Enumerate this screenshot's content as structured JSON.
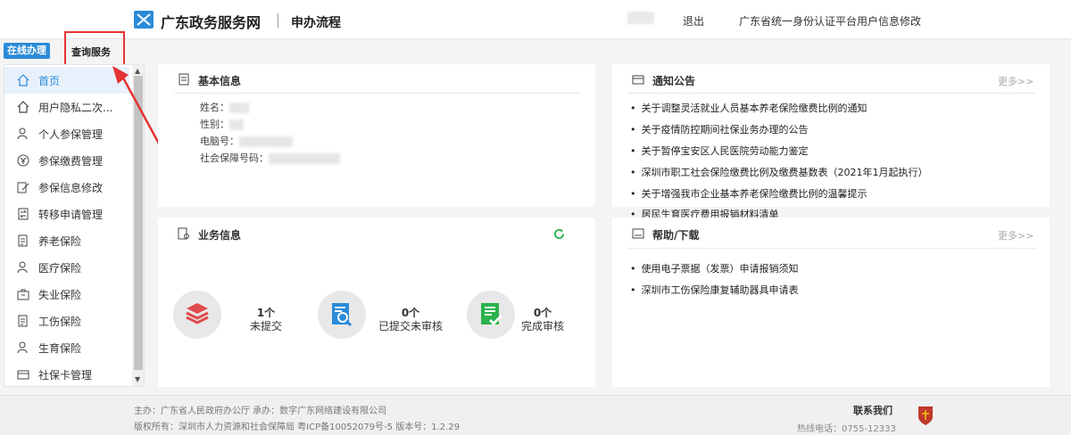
{
  "header": {
    "brand": "广东政务服务网",
    "subtitle": "申办流程",
    "logout": "退出",
    "profile_edit": "广东省统一身份认证平台用户信息修改"
  },
  "tabs": {
    "online": "在线办理",
    "query": "查询服务"
  },
  "sidebar": {
    "items": [
      {
        "label": "首页",
        "icon": "home-icon"
      },
      {
        "label": "用户隐私二次...",
        "icon": "home-icon"
      },
      {
        "label": "个人参保管理",
        "icon": "person-icon"
      },
      {
        "label": "参保缴费管理",
        "icon": "money-icon"
      },
      {
        "label": "参保信息修改",
        "icon": "edit-icon"
      },
      {
        "label": "转移申请管理",
        "icon": "transfer-icon"
      },
      {
        "label": "养老保险",
        "icon": "document-icon"
      },
      {
        "label": "医疗保险",
        "icon": "person-icon"
      },
      {
        "label": "失业保险",
        "icon": "briefcase-icon"
      },
      {
        "label": "工伤保险",
        "icon": "document-icon"
      },
      {
        "label": "生育保险",
        "icon": "person-icon"
      },
      {
        "label": "社保卡管理",
        "icon": "card-icon"
      }
    ]
  },
  "basic_info": {
    "title": "基本信息",
    "rows": [
      {
        "label": "姓名："
      },
      {
        "label": "性别："
      },
      {
        "label": "电脑号："
      },
      {
        "label": "社会保障号码："
      }
    ]
  },
  "notice": {
    "title": "通知公告",
    "more": "更多>>",
    "items": [
      "关于调整灵活就业人员基本养老保险缴费比例的通知",
      "关于疫情防控期间社保业务办理的公告",
      "关于暂停宝安区人民医院劳动能力鉴定",
      "深圳市职工社会保险缴费比例及缴费基数表（2021年1月起执行）",
      "关于增强我市企业基本养老保险缴费比例的温馨提示",
      "居民生育医疗费用报销材料清单"
    ]
  },
  "business": {
    "title": "业务信息",
    "stats": [
      {
        "count": "1个",
        "label": "未提交"
      },
      {
        "count": "0个",
        "label": "已提交未审核"
      },
      {
        "count": "0个",
        "label": "完成审核"
      }
    ]
  },
  "help": {
    "title": "帮助/下载",
    "more": "更多>>",
    "items": [
      "使用电子票据（发票）申请报销须知",
      "深圳市工伤保险康复辅助器具申请表"
    ]
  },
  "footer": {
    "line1": "主办：广东省人民政府办公厅    承办：数字广东网络建设有限公司",
    "line2": "版权所有：深圳市人力资源和社会保障局    粤ICP备10052079号-5    版本号：1.2.29",
    "contact": "联系我们",
    "phone": "热线电话：0755-12333"
  },
  "colors": {
    "accent": "#2b8bd8",
    "highlight_red": "#e53333",
    "refresh_green": "#2bb24c"
  }
}
